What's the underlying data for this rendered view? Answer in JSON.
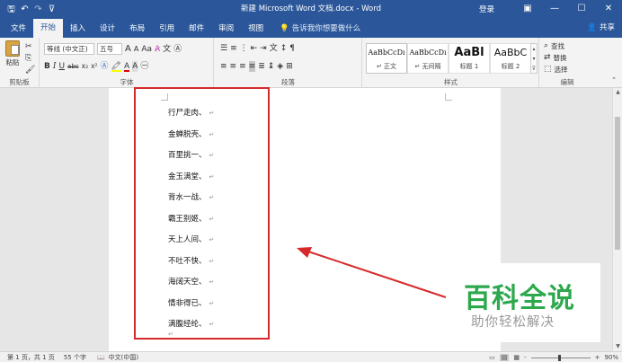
{
  "titlebar": {
    "title": "新建 Microsoft Word 文档.docx - Word",
    "login": "登录",
    "qat_icons": [
      "save-icon",
      "undo-icon",
      "redo-icon",
      "customize-qat-icon"
    ]
  },
  "tabs": [
    "文件",
    "开始",
    "插入",
    "设计",
    "布局",
    "引用",
    "邮件",
    "审阅",
    "视图"
  ],
  "active_tab": "开始",
  "tell_me": "告诉我你想要做什么",
  "share": "共享",
  "ribbon": {
    "clipboard": {
      "paste": "粘贴",
      "label": "剪贴板"
    },
    "font": {
      "font_name": "等线 (中文正)",
      "font_size": "五号",
      "size_grow": "A",
      "size_shrink": "A",
      "aa": "Aa",
      "label": "字体"
    },
    "paragraph": {
      "label": "段落"
    },
    "styles": {
      "label": "样式",
      "items": [
        {
          "sample": "AaBbCcDı",
          "name": "正文"
        },
        {
          "sample": "AaBbCcDı",
          "name": "无间隔"
        },
        {
          "sample": "AaBl",
          "name": "标题 1"
        },
        {
          "sample": "AaBbC",
          "name": "标题 2"
        }
      ]
    },
    "editing": {
      "label": "编辑",
      "find": "查找",
      "replace": "替换",
      "select": "选择"
    }
  },
  "document": {
    "lines": [
      "行尸走肉、",
      "金蝉脱壳、",
      "百里挑一、",
      "金玉满堂、",
      "背水一战、",
      "霸王别姬、",
      "天上人间、",
      "不吐不快、",
      "海阔天空、",
      "情非得已、",
      "满腹经纶、"
    ],
    "pilcrow": "↵",
    "highlight_color": "#d62a2a"
  },
  "watermark": {
    "title": "百科全说",
    "subtitle": "助你轻松解决"
  },
  "statusbar": {
    "page": "第 1 页，共 1 页",
    "words": "55 个字",
    "lang": "中文(中国)",
    "zoom_minus": "-",
    "zoom_plus": "+",
    "zoom": "90%"
  },
  "colors": {
    "brand": "#2b579a",
    "watermark_green": "#2da84d",
    "annotation_red": "#d62a2a"
  }
}
